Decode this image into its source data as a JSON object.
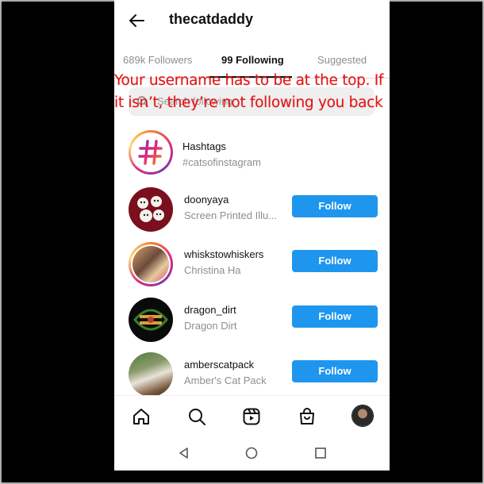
{
  "header": {
    "title": "thecatdaddy",
    "back_icon": "arrow-left-icon"
  },
  "tabs": [
    {
      "label": "689k Followers"
    },
    {
      "label": "99 Following"
    },
    {
      "label": "Suggested"
    }
  ],
  "search": {
    "placeholder": "Search following",
    "icon": "search-icon"
  },
  "annotation": {
    "text": "Your username has to be at the top. If it isn’t, they’re not following you back",
    "color": "#f01010"
  },
  "hashtags": {
    "title": "Hashtags",
    "subtitle": "#catsofinstagram",
    "icon": "hashtag-icon"
  },
  "following": [
    {
      "username": "doonyaya",
      "name": "Screen Printed Illu...",
      "button": "Follow"
    },
    {
      "username": "whiskstowhiskers",
      "name": "Christina Ha",
      "button": "Follow"
    },
    {
      "username": "dragon_dirt",
      "name": "Dragon Dirt",
      "button": "Follow"
    },
    {
      "username": "amberscatpack",
      "name": "Amber's Cat Pack",
      "button": "Follow"
    }
  ],
  "bottom_nav": [
    "home-icon",
    "search-icon",
    "reels-icon",
    "shop-icon",
    "profile-avatar"
  ],
  "system_nav": [
    "back-triangle-icon",
    "home-circle-icon",
    "recents-square-icon"
  ],
  "colors": {
    "follow_button": "#1e96ee",
    "annotation": "#f01010",
    "muted_text": "#8e8e8e"
  }
}
